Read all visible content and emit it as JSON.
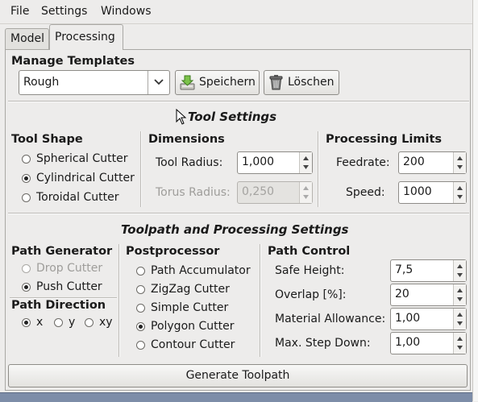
{
  "menubar": {
    "items": [
      "File",
      "Settings",
      "Windows"
    ]
  },
  "tabs": [
    "Model",
    "Processing"
  ],
  "templates": {
    "title": "Manage Templates",
    "selected": "Rough",
    "save_label": "Speichern",
    "delete_label": "Löschen"
  },
  "tool_settings": {
    "title": "Tool Settings",
    "shape": {
      "title": "Tool Shape",
      "options": [
        "Spherical Cutter",
        "Cylindrical Cutter",
        "Toroidal Cutter"
      ],
      "selected": "Cylindrical Cutter"
    },
    "dimensions": {
      "title": "Dimensions",
      "tool_radius_label": "Tool Radius:",
      "tool_radius": "1,000",
      "torus_radius_label": "Torus Radius:",
      "torus_radius": "0,250"
    },
    "limits": {
      "title": "Processing Limits",
      "feedrate_label": "Feedrate:",
      "feedrate": "200",
      "speed_label": "Speed:",
      "speed": "1000"
    }
  },
  "toolpath": {
    "title": "Toolpath and Processing Settings",
    "generator": {
      "title": "Path Generator",
      "options": [
        "Drop Cutter",
        "Push Cutter"
      ],
      "selected": "Push Cutter"
    },
    "direction": {
      "title": "Path Direction",
      "options": [
        "x",
        "y",
        "xy"
      ],
      "selected": "x"
    },
    "postprocessor": {
      "title": "Postprocessor",
      "options": [
        "Path Accumulator",
        "ZigZag Cutter",
        "Simple Cutter",
        "Polygon Cutter",
        "Contour Cutter"
      ],
      "selected": "Polygon Cutter"
    },
    "control": {
      "title": "Path Control",
      "safe_height_label": "Safe Height:",
      "safe_height": "7,5",
      "overlap_label": "Overlap [%]:",
      "overlap": "20",
      "allowance_label": "Material Allowance:",
      "allowance": "1,00",
      "stepdown_label": "Max. Step Down:",
      "stepdown": "1,00"
    }
  },
  "generate_label": "Generate Toolpath",
  "colors": {
    "background": "#edeceb",
    "disabled_text": "#9e9d9a",
    "taskbar": "#7d8da8"
  }
}
